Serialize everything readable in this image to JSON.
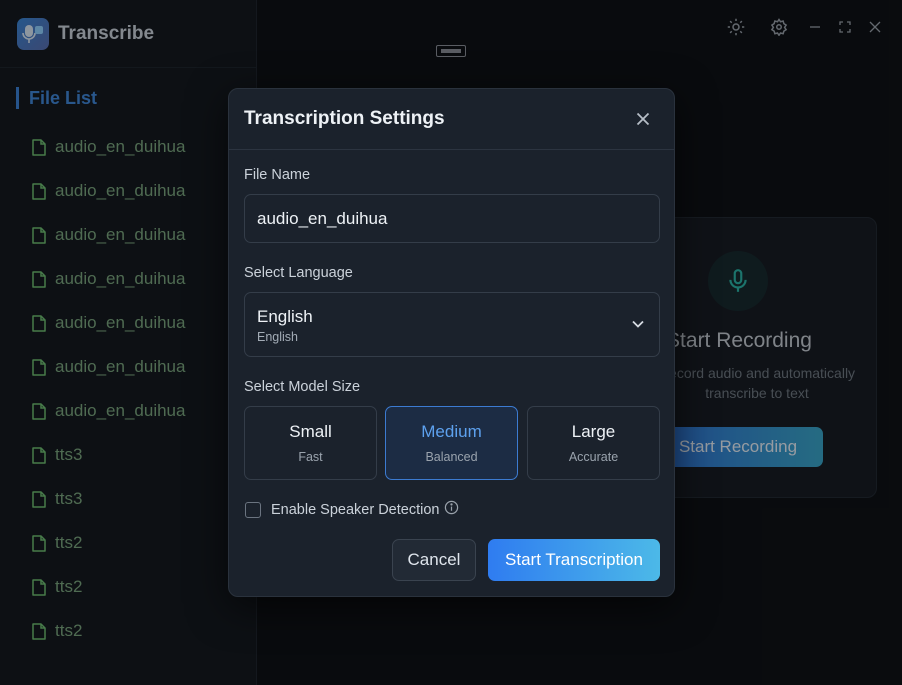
{
  "app": {
    "name": "Transcribe"
  },
  "sidebar": {
    "section_title": "File List",
    "files": [
      "audio_en_duihua",
      "audio_en_duihua",
      "audio_en_duihua",
      "audio_en_duihua",
      "audio_en_duihua",
      "audio_en_duihua",
      "audio_en_duihua",
      "tts3",
      "tts3",
      "tts2",
      "tts2",
      "tts2"
    ]
  },
  "topbar": {
    "icons": [
      "sun-icon",
      "gear-icon",
      "minimize-icon",
      "maximize-icon",
      "close-icon"
    ]
  },
  "record_card": {
    "title": "Start Recording",
    "description_line1": "Record audio and automatically",
    "description_line2": "transcribe to text",
    "button_label": "Start Recording"
  },
  "modal": {
    "title": "Transcription Settings",
    "file_name_label": "File Name",
    "file_name_value": "audio_en_duihua",
    "language_label": "Select Language",
    "language_selected": "English",
    "language_selected_sub": "English",
    "model_label": "Select Model Size",
    "model_sizes": [
      {
        "name": "Small",
        "desc": "Fast"
      },
      {
        "name": "Medium",
        "desc": "Balanced"
      },
      {
        "name": "Large",
        "desc": "Accurate"
      }
    ],
    "selected_model": "Medium",
    "speaker_detection_label": "Enable Speaker Detection",
    "speaker_detection_checked": false,
    "cancel_label": "Cancel",
    "start_label": "Start Transcription"
  },
  "colors": {
    "accent": "#3f86d8",
    "file_text": "#7aa57e",
    "primary_gradient_start": "#2f7cf0",
    "primary_gradient_end": "#4cb9e8"
  }
}
